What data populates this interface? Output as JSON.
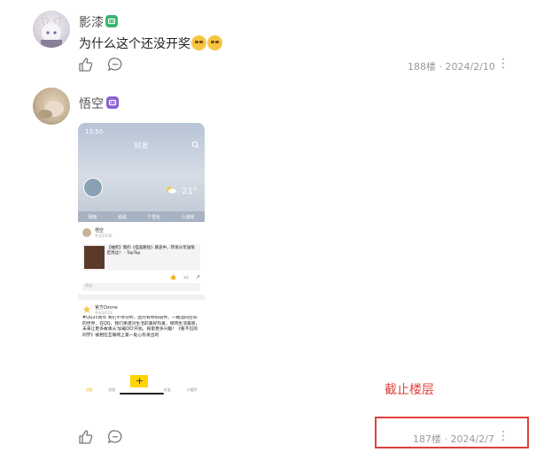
{
  "posts": [
    {
      "username": "影漆",
      "comment": "为什么这个还没开奖",
      "floor": "188楼",
      "date": "2024/2/10",
      "separator": "·",
      "badge_color": "#3cb371"
    },
    {
      "username": "悟空",
      "floor": "187楼",
      "date": "2024/2/7",
      "separator": "·",
      "badge_color": "#8a63d2"
    }
  ],
  "phone": {
    "time": "13:50",
    "title": "好友",
    "temperature": "21°",
    "tabs": [
      "相册",
      "说说",
      "个性化",
      "小游戏"
    ],
    "feed1": {
      "name": "悟空",
      "time": "今天13:50",
      "share_text": "【抽奖】我的《怪盗路径》路途中，转发分享送限定周边！ - TapTap",
      "action": "评论"
    },
    "feed2": {
      "name": "官方Qzone",
      "time": "今天10:23",
      "body": "#QQ25周年 我们不停分析，因为有你的陪伴。一路边同空间的世界，在QQ，我们承诺对生活的美好热爱，保持生活美感，未来让更多故事从'加载QQ'开始，探索更多兴趣！《看不见的同学》被相在互联网上第一处心形发出的"
    },
    "nav": [
      "动态",
      "消息",
      "",
      "好友",
      "小程序"
    ]
  },
  "annotation": "截止楼层",
  "colors": {
    "highlight": "#e0403a",
    "meta": "#9a9a9a"
  }
}
